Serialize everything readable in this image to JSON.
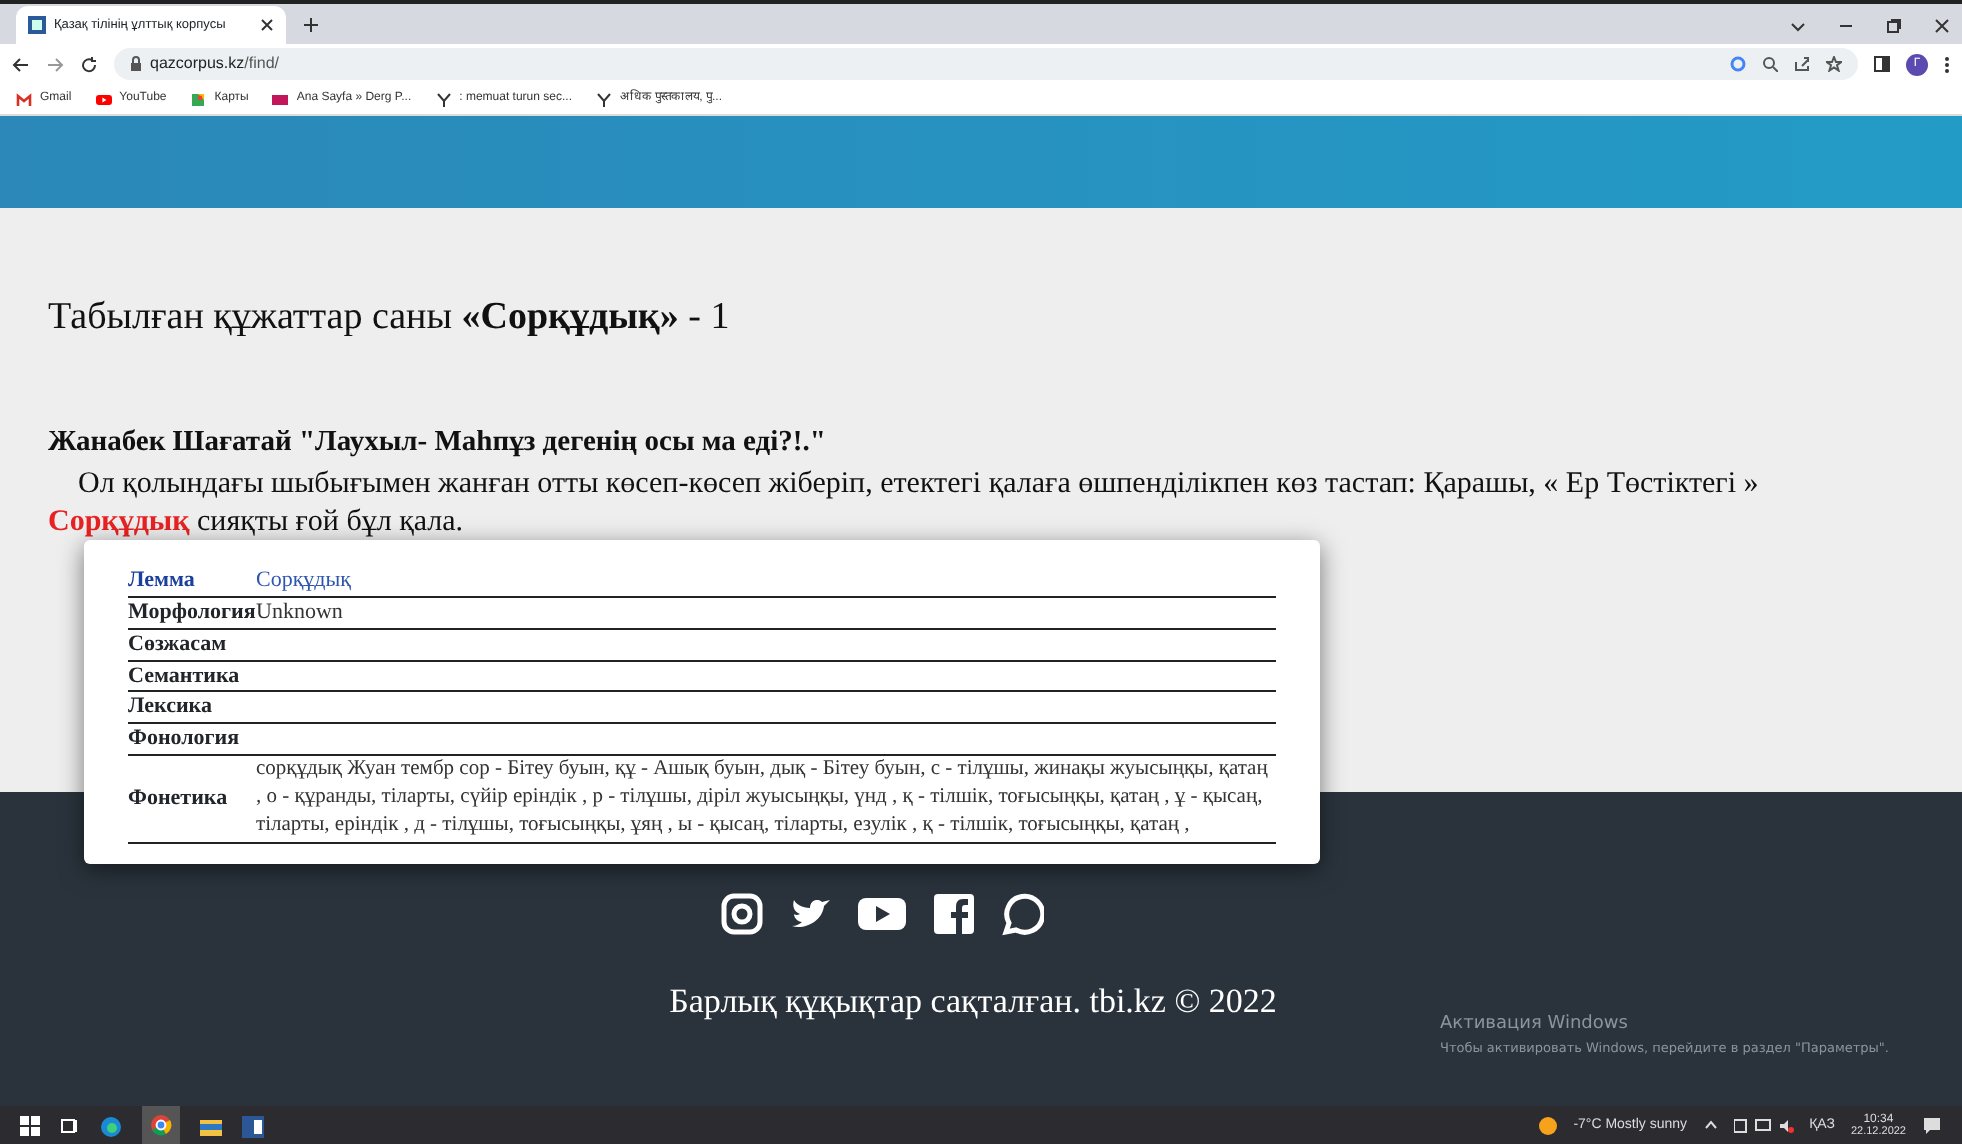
{
  "browser": {
    "tab": {
      "title": "Қазақ тілінің ұлттық корпусы",
      "selected": true
    },
    "url_host": "qazcorpus.kz",
    "url_path": "/find/",
    "bookmarks": [
      {
        "label": "Gmail",
        "kind": "gmail"
      },
      {
        "label": "YouTube",
        "kind": "youtube"
      },
      {
        "label": "Карты",
        "kind": "maps"
      },
      {
        "label": "Ana Sayfa » Derg P...",
        "kind": "dp"
      },
      {
        "label": ": memuat turun sec...",
        "kind": "y"
      },
      {
        "label": "अधिक पुस्तकालय, पु...",
        "kind": "y"
      }
    ],
    "avatar": "Г"
  },
  "result": {
    "title": "Табылған құжаттар саны **«Сорқұдық»** - 1"
  },
  "document": {
    "heading": "Жанабек Шағатай \"Лаухыл- Маһпұз дегенің осы ма еді?!.\"",
    "text_before": "Ол қолындағы шыбығымен жанған отты көсеп-көсеп жіберіп, етектегі қалаға өшпенділікпен көз тастап: Қарашы, « Ер Төстіктегі »",
    "highlight": "Сорқұдық",
    "text_after": " сияқты ғой бұл қала."
  },
  "popup": {
    "rows": [
      {
        "label": "Лемма",
        "value": "Сорқұдық",
        "kind": "lemma"
      },
      {
        "label": "Морфология",
        "value": "Unknown",
        "kind": "plain"
      },
      {
        "label": "Сөзжасам",
        "kind": "plain"
      },
      {
        "label": "Семантика",
        "kind": "plain"
      },
      {
        "label": "Лексика",
        "kind": "plain"
      },
      {
        "label": "Фонология",
        "kind": "plain"
      },
      {
        "label": "Фонетика",
        "value": "сорқұдық Жуан тембр сор - Бітеу буын, құ - Ашық буын, дық - Бітеу буын, с - тілұшы, жинақы жуысыңқы, қатаң , о - құранды, тіларты, сүйір еріндік , р - тілұшы, діріл жуысыңқы, үнд , қ - тілшік, тоғысыңқы, қатаң , ұ - қысаң, тіларты, еріндік , д - тілұшы, тоғысыңқы, ұяң , ы - қысаң, тіларты, езулік , қ - тілшік, тоғысыңқы, қатаң ,",
        "kind": "plain"
      }
    ]
  },
  "footer": {
    "copyright": "Барлық құқықтар сақталған. tbi.kz © 2022"
  },
  "activation": {
    "title": "Активация Windows",
    "text": "Чтобы активировать Windows, перейдите в раздел \"Параметры\"."
  },
  "taskbar": {
    "weather": "-7°C Mostly sunny",
    "language": "ҚАЗ",
    "time": "10:34",
    "date": "22.12.2022"
  }
}
